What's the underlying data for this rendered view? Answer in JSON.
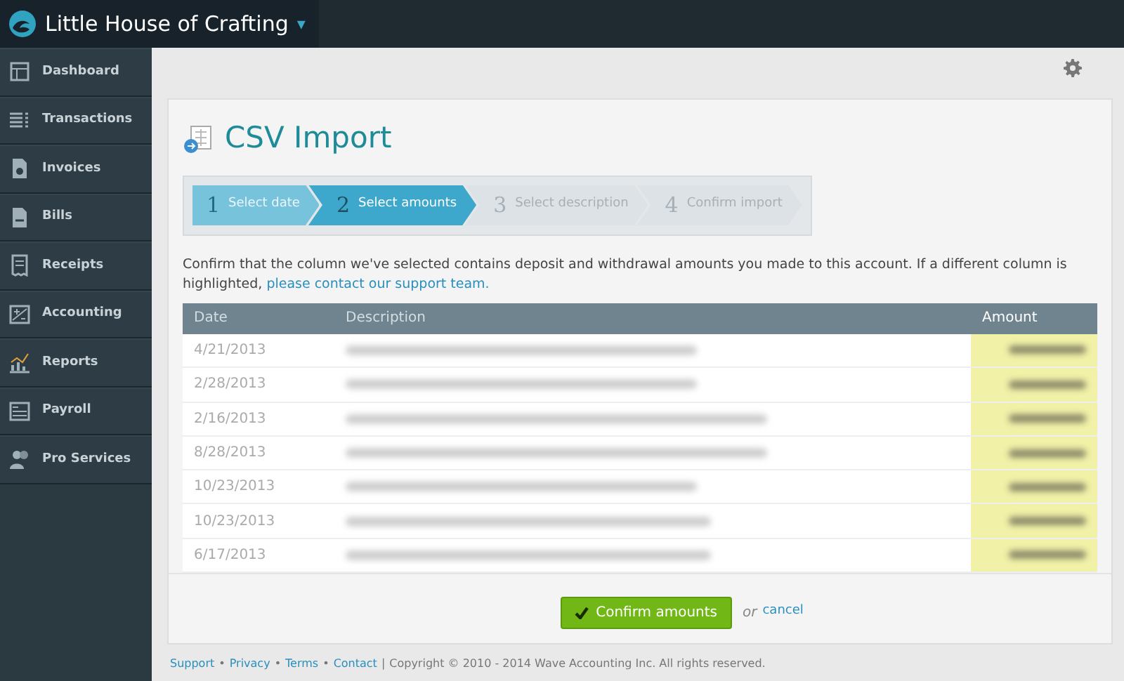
{
  "header": {
    "business_name": "Little House of Crafting",
    "menu_caret": "▾"
  },
  "sidebar": {
    "items": [
      {
        "label": "Dashboard",
        "selected": false
      },
      {
        "label": "Transactions",
        "selected": false
      },
      {
        "label": "Invoices",
        "selected": false
      },
      {
        "label": "Bills",
        "selected": false
      },
      {
        "label": "Receipts",
        "selected": false
      },
      {
        "label": "Accounting",
        "selected": false
      },
      {
        "label": "Reports",
        "selected": false
      },
      {
        "label": "Payroll",
        "selected": false
      },
      {
        "label": "Pro Services",
        "selected": false
      }
    ]
  },
  "page": {
    "title": "CSV Import",
    "steps": [
      {
        "number": "1",
        "label": "Select date",
        "completed": true,
        "selected": false
      },
      {
        "number": "2",
        "label": "Select amounts",
        "completed": false,
        "selected": true
      },
      {
        "number": "3",
        "label": "Select description",
        "completed": false,
        "selected": false
      },
      {
        "number": "4",
        "label": "Confirm import",
        "completed": false,
        "selected": false
      }
    ],
    "instructions": "Confirm that the column we've selected contains deposit and withdrawal amounts you made to this account. If a different column is highlighted, ",
    "support_link": "please contact our support team.",
    "table": {
      "columns": [
        {
          "label": "Date",
          "selected": false
        },
        {
          "label": "Description",
          "selected": false
        },
        {
          "label": "Amount",
          "selected": true
        }
      ],
      "rows": [
        {
          "date": "4/21/2013",
          "description_redacted": true,
          "amount_redacted": true
        },
        {
          "date": "2/28/2013",
          "description_redacted": true,
          "amount_redacted": true
        },
        {
          "date": "2/16/2013",
          "description_redacted": true,
          "amount_redacted": true
        },
        {
          "date": "8/28/2013",
          "description_redacted": true,
          "amount_redacted": true
        },
        {
          "date": "10/23/2013",
          "description_redacted": true,
          "amount_redacted": true
        },
        {
          "date": "10/23/2013",
          "description_redacted": true,
          "amount_redacted": true
        },
        {
          "date": "6/17/2013",
          "description_redacted": true,
          "amount_redacted": true
        }
      ]
    },
    "confirm_button": "Confirm amounts",
    "or_text": "or",
    "cancel_link": "cancel"
  },
  "footer": {
    "links": [
      "Support",
      "Privacy",
      "Terms",
      "Contact"
    ],
    "separator": "•",
    "divider": "|",
    "copyright": "Copyright © 2010 - 2014 Wave Accounting Inc. All rights reserved."
  }
}
